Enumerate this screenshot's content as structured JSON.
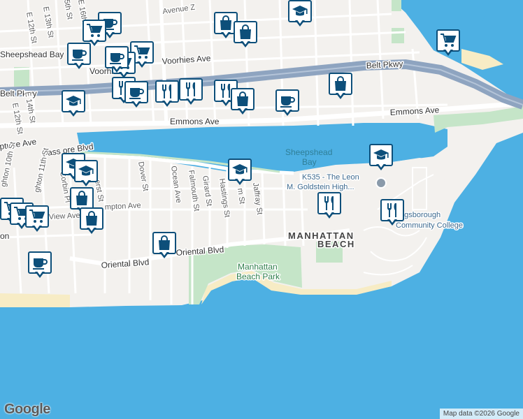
{
  "map": {
    "colors": {
      "water": "#4db0e3",
      "land": "#f3f1ee",
      "park": "#c5e5c8",
      "beach": "#f7ecc5",
      "highway": "#8ea4c0",
      "road": "#ffffff",
      "marker_border": "#0d4f7a"
    },
    "labels": {
      "sheepshead_bay_neighborhood": "Sheepshead Bay",
      "voorhies_ave": "Voorhies Ave",
      "voorhies_ave_partial": "Voorhi",
      "avenue_z": "Avenue Z",
      "belt_pkwy_west": "Belt Pkwy",
      "belt_pkwy_east": "Belt Pkwy",
      "emmons_ave_west": "Emmons Ave",
      "emmons_ave_east": "Emmons Ave",
      "e_13th_st": "E 13th St",
      "e_12th_st": "E 12th St",
      "e_15th_st": "5th St",
      "e_16th_st": "E 16th St",
      "e_14th_st": "E 14th St",
      "e_12th_st_lower": "E 12th St",
      "neptune_ave": "ptune Ave",
      "shore_blvd": "Cass      ore Blvd",
      "brighton_10th": "ghton 10th St",
      "brighton_11th": "ghton 11th St",
      "corbin_pl": "Corbin Pl",
      "amherst_st": "erst St",
      "hampton_ave": "mpton Ave",
      "view_ave": "View Ave",
      "dover_st": "Dover St",
      "ocean_ave": "Ocean Ave",
      "falmouth_st": "Falmouth St",
      "girard_st": "Girard St",
      "hastings_st": "Hastings St",
      "exeter_st": "m St",
      "jaffray_st": "Jaffray St",
      "oriental_blvd_west": "Oriental Blvd",
      "oriental_blvd_east": "Oriental Blvd",
      "sheepshead_bay_water_1": "Sheepshead",
      "sheepshead_bay_water_2": "Bay",
      "school_line_1": "K535 - The Leon",
      "school_line_2": "M. Goldstein High...",
      "manhattan_beach": "MANHATTAN",
      "manhattan_beach_2": "BEACH",
      "manhattan_beach_park_1": "Manhattan",
      "manhattan_beach_park_2": "Beach Park",
      "kingsborough_1": "ngsborough",
      "kingsborough_2": "Community College",
      "left_edge": "on"
    },
    "markers": [
      {
        "icon": "coffee-icon",
        "label": "Coffee"
      },
      {
        "icon": "cart-icon",
        "label": "Grocery"
      },
      {
        "icon": "bag-icon",
        "label": "Shopping"
      },
      {
        "icon": "school-icon",
        "label": "School"
      },
      {
        "icon": "restaurant-icon",
        "label": "Restaurant"
      }
    ]
  },
  "footer": {
    "logo": "Google",
    "attribution": "Map data ©2026 Google"
  }
}
